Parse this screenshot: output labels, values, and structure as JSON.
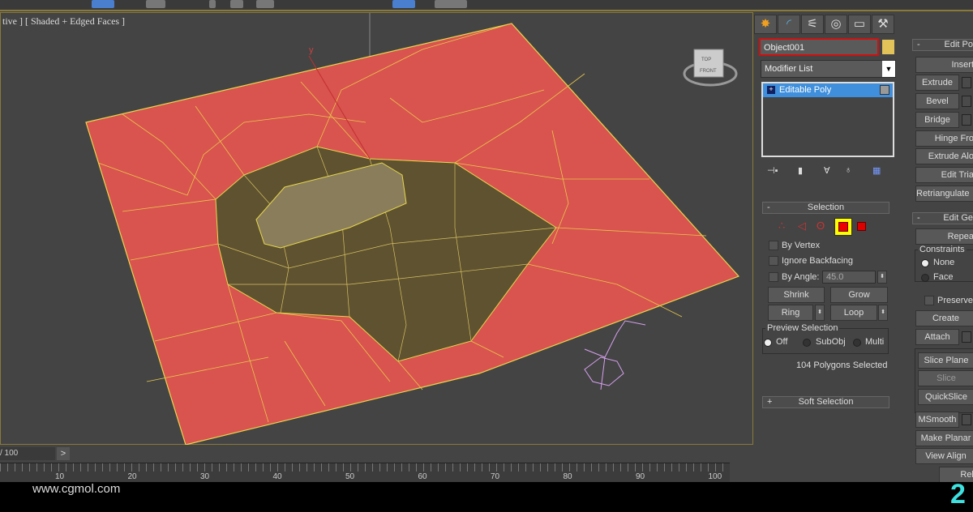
{
  "viewport": {
    "label": "tive ] [ Shaded + Edged Faces ]",
    "axis_label": "y",
    "viewcube": {
      "top": "TOP",
      "front": "FRONT"
    },
    "colors": {
      "plane": "#d9534f",
      "edges": "#e8d84a",
      "hole": "#5e5230",
      "rock": "#8a7d5c"
    }
  },
  "panel": {
    "tabs": [
      {
        "icon": "create-icon"
      },
      {
        "icon": "modify-icon"
      },
      {
        "icon": "hierarchy-icon"
      },
      {
        "icon": "motion-icon"
      },
      {
        "icon": "display-icon"
      },
      {
        "icon": "utilities-icon"
      }
    ],
    "object_name": "Object001",
    "object_color": "#e2c35a",
    "modifier_list": "Modifier List",
    "stack": [
      "Editable Poly"
    ],
    "selection": {
      "title": "Selection",
      "sign": "-",
      "levels": [
        "vertex",
        "edge",
        "border",
        "polygon",
        "element"
      ],
      "active_level": "polygon",
      "by_vertex": "By Vertex",
      "ignore_backfacing": "Ignore Backfacing",
      "by_angle": "By Angle:",
      "angle_value": "45.0",
      "shrink": "Shrink",
      "grow": "Grow",
      "ring": "Ring",
      "loop": "Loop",
      "preview_title": "Preview Selection",
      "preview_options": [
        "Off",
        "SubObj",
        "Multi"
      ],
      "preview_selected": "Off",
      "status": "104 Polygons Selected"
    },
    "soft_selection": {
      "title": "Soft Selection",
      "sign": "+"
    },
    "edit_polygons": {
      "title": "Edit Po",
      "sign": "-",
      "buttons": [
        "Insert",
        "Extrude",
        "Bevel",
        "Bridge",
        "Hinge Fro",
        "Extrude Alo",
        "Edit Tria",
        "Retriangulate"
      ]
    },
    "edit_geometry": {
      "title": "Edit Ge",
      "sign": "-",
      "repeat": "Repea",
      "constraints": "Constraints",
      "none": "None",
      "face": "Face",
      "preserve": "Preserve",
      "buttons": [
        "Create",
        "Attach",
        "Slice Plane",
        "Slice",
        "QuickSlice",
        "MSmooth",
        "Make Planar",
        "View Align",
        "Rela"
      ]
    }
  },
  "timeline": {
    "frame": "/ 100",
    "next": ">",
    "ticks": [
      "10",
      "20",
      "30",
      "40",
      "50",
      "60",
      "70",
      "80",
      "90",
      "100"
    ]
  },
  "footer": {
    "watermark": "www.cgmol.com",
    "step": "2"
  }
}
